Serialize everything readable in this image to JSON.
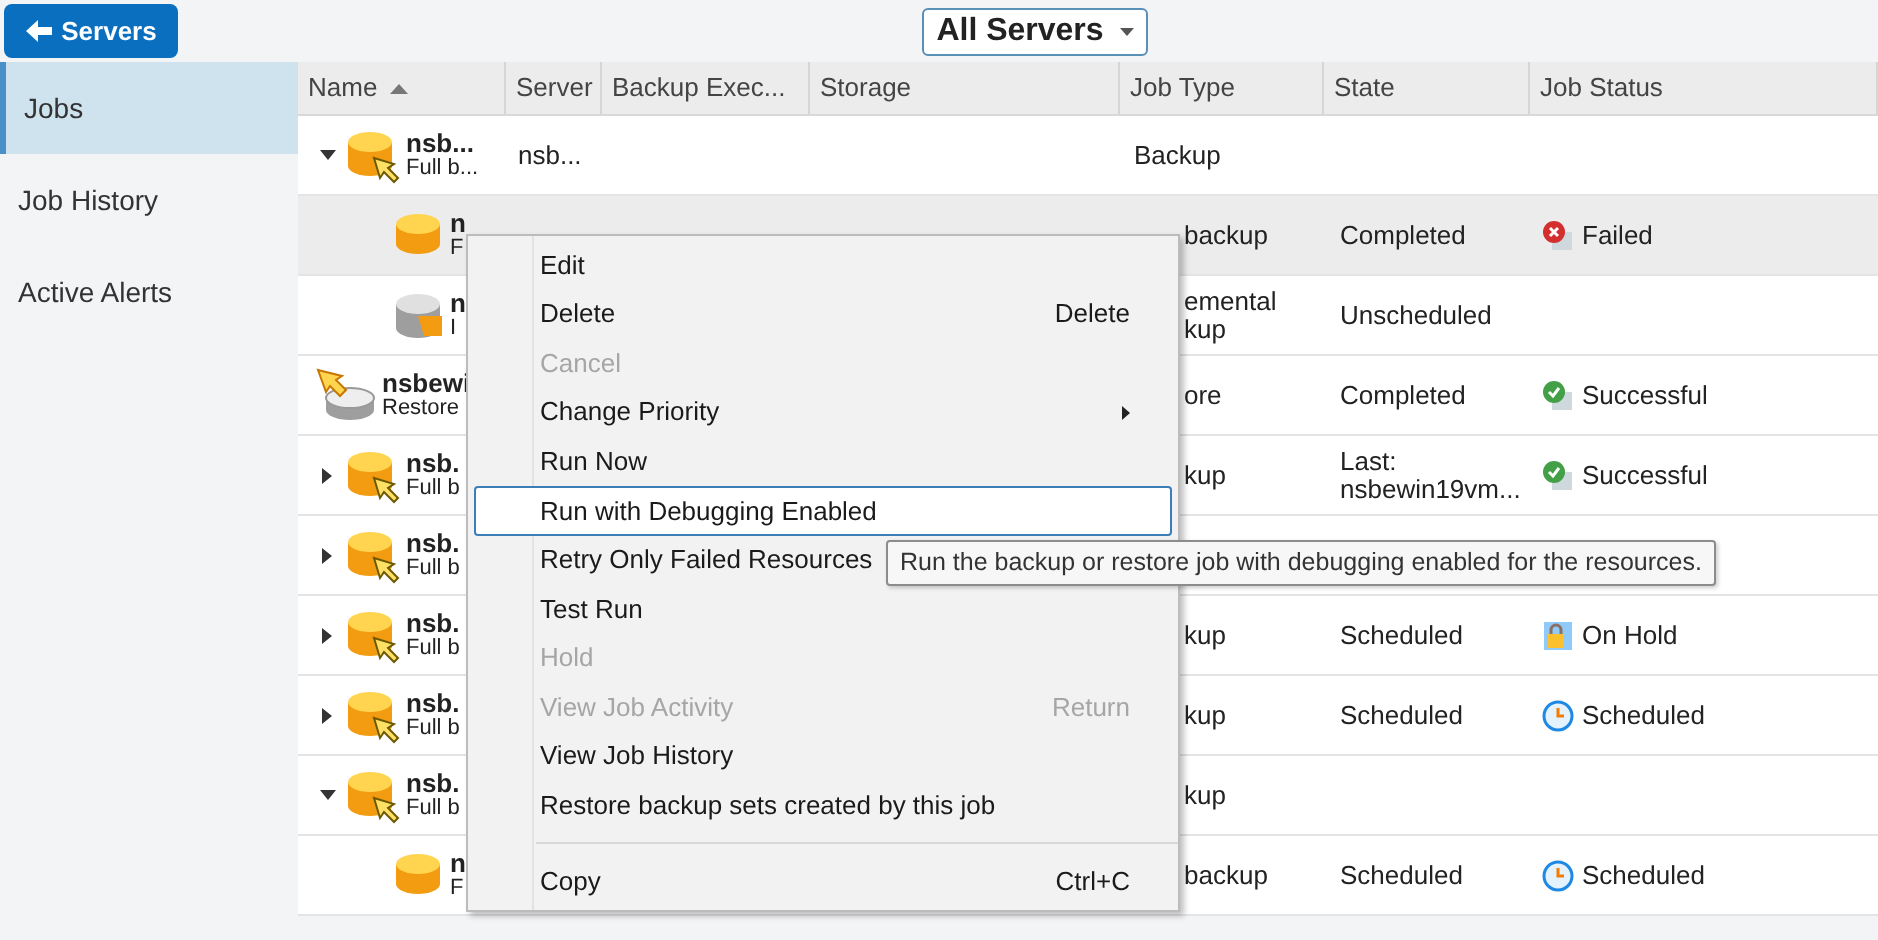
{
  "back_button": {
    "label": "Servers"
  },
  "server_filter": {
    "value": "All Servers"
  },
  "sidebar": {
    "items": [
      {
        "label": "Jobs",
        "selected": true
      },
      {
        "label": "Job History",
        "selected": false
      },
      {
        "label": "Active Alerts",
        "selected": false
      }
    ]
  },
  "table": {
    "columns": [
      "Name",
      "Server",
      "Backup Exec...",
      "Storage",
      "Job Type",
      "State",
      "Job Status"
    ],
    "rows": [
      {
        "kind": "backup",
        "expanded": true,
        "child": false,
        "selected": false,
        "name": "nsb...",
        "sub": "Full b...",
        "server": "nsb...",
        "job_type": "Backup"
      },
      {
        "kind": "backup-child",
        "child": true,
        "selected": true,
        "name": "n",
        "sub": "F",
        "job_type": "backup",
        "state": "Completed",
        "status": {
          "kind": "failed",
          "label": "Failed"
        }
      },
      {
        "kind": "incremental",
        "child": true,
        "selected": false,
        "name": "n",
        "sub": "I",
        "job_type": "emental kup",
        "state": "Unscheduled"
      },
      {
        "kind": "restore",
        "child": false,
        "selected": false,
        "name": "nsbewi",
        "sub": "Restore",
        "job_type": "ore",
        "state": "Completed",
        "status": {
          "kind": "successful",
          "label": "Successful"
        }
      },
      {
        "kind": "backup",
        "expanded": false,
        "child": false,
        "selected": false,
        "name": "nsb.",
        "sub": "Full b",
        "job_type": "kup",
        "state": "Last: nsbewin19vm...",
        "status": {
          "kind": "successful",
          "label": "Successful"
        }
      },
      {
        "kind": "backup",
        "expanded": false,
        "child": false,
        "selected": false,
        "name": "nsb.",
        "sub": "Full b"
      },
      {
        "kind": "backup",
        "expanded": false,
        "child": false,
        "selected": false,
        "name": "nsb.",
        "sub": "Full b",
        "job_type": "kup",
        "state": "Scheduled",
        "status": {
          "kind": "on-hold",
          "label": "On Hold"
        }
      },
      {
        "kind": "backup",
        "expanded": false,
        "child": false,
        "selected": false,
        "name": "nsb.",
        "sub": "Full b",
        "job_type": "kup",
        "state": "Scheduled",
        "status": {
          "kind": "scheduled",
          "label": "Scheduled"
        }
      },
      {
        "kind": "backup",
        "expanded": true,
        "child": false,
        "selected": false,
        "name": "nsb.",
        "sub": "Full b",
        "job_type": "kup"
      },
      {
        "kind": "backup-child",
        "child": true,
        "selected": false,
        "name": "n",
        "sub": "F",
        "job_type": "backup",
        "state": "Scheduled",
        "status": {
          "kind": "scheduled",
          "label": "Scheduled"
        }
      }
    ]
  },
  "context_menu": {
    "items": [
      {
        "label": "Edit",
        "disabled": false,
        "selected": false
      },
      {
        "label": "Delete",
        "shortcut": "Delete",
        "disabled": false,
        "selected": false
      },
      {
        "label": "Cancel",
        "disabled": true,
        "selected": false
      },
      {
        "label": "Change Priority",
        "submenu": true,
        "disabled": false,
        "selected": false
      },
      {
        "label": "Run Now",
        "disabled": false,
        "selected": false
      },
      {
        "label": "Run with Debugging Enabled",
        "disabled": false,
        "selected": true
      },
      {
        "label": "Retry Only Failed Resources",
        "disabled": false,
        "selected": false
      },
      {
        "label": "Test Run",
        "disabled": false,
        "selected": false
      },
      {
        "label": "Hold",
        "disabled": true,
        "selected": false
      },
      {
        "label": "View Job Activity",
        "shortcut": "Return",
        "disabled": true,
        "selected": false
      },
      {
        "label": "View Job History",
        "disabled": false,
        "selected": false
      },
      {
        "label": "Restore backup sets created by this job",
        "disabled": false,
        "selected": false
      },
      {
        "kind": "separator"
      },
      {
        "label": "Copy",
        "shortcut": "Ctrl+C",
        "disabled": false,
        "selected": false
      }
    ]
  },
  "tooltip": {
    "text": "Run the backup or restore job with debugging enabled for the resources."
  }
}
